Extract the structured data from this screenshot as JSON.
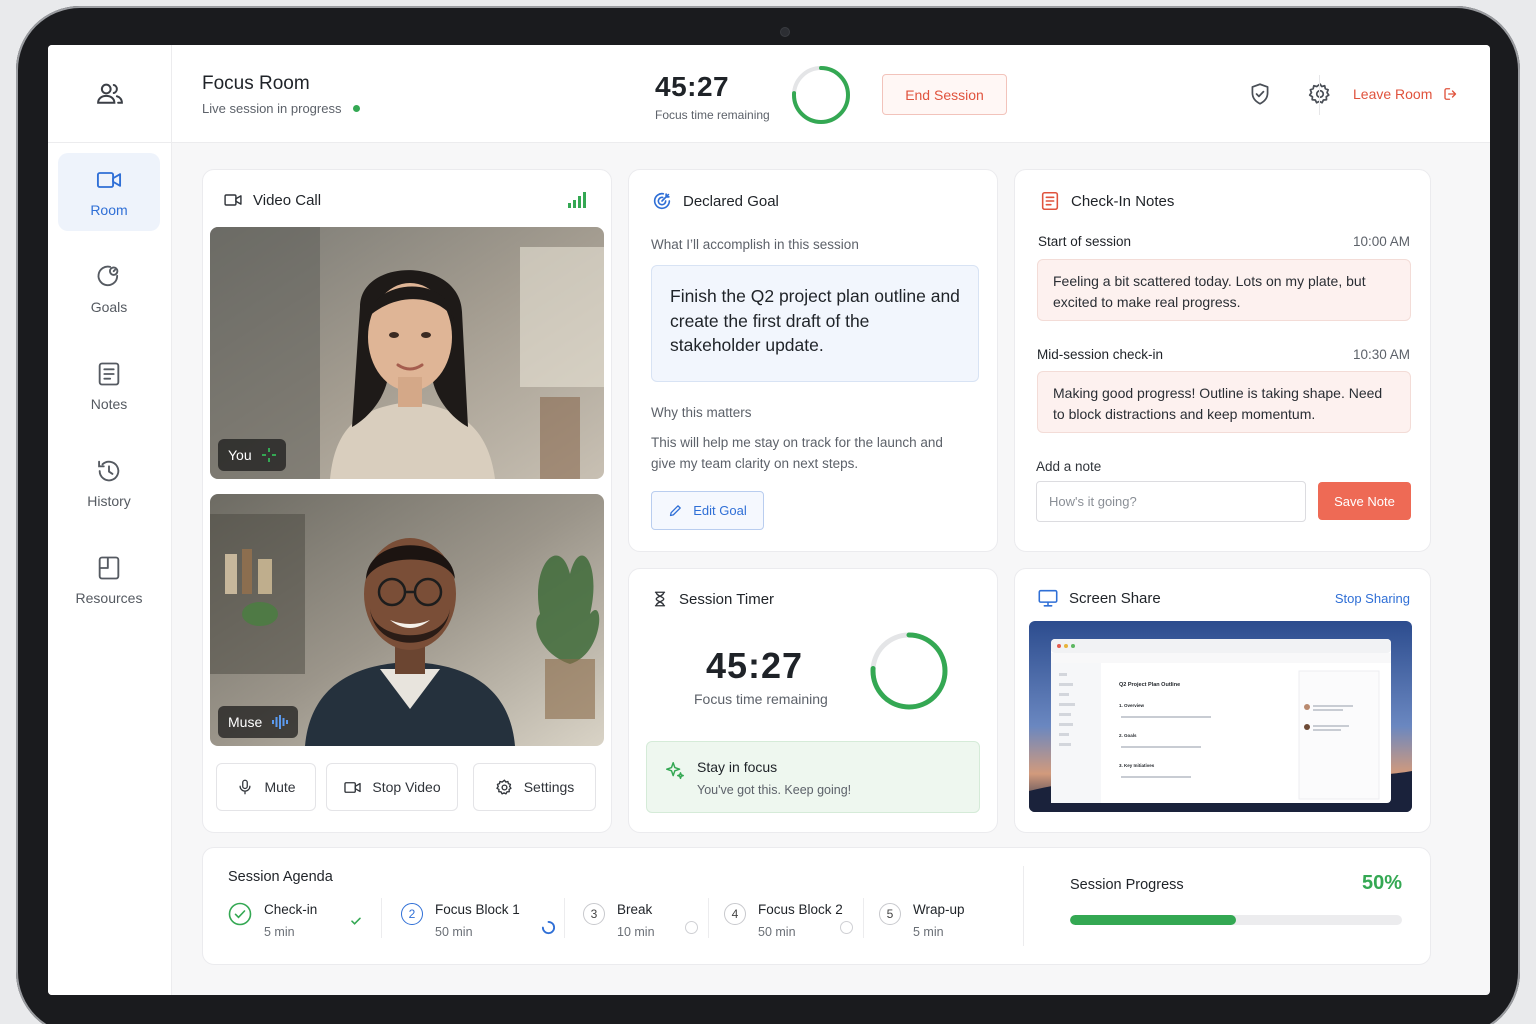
{
  "header": {
    "title": "Focus Room",
    "subtitle": "Live session in progress",
    "timer": "45:27",
    "timer_caption": "Focus time remaining",
    "end_session": "End Session",
    "leave_room": "Leave Room"
  },
  "sidebar": {
    "items": [
      {
        "label": "Room",
        "icon": "video-icon",
        "active": true
      },
      {
        "label": "Goals",
        "icon": "target-icon"
      },
      {
        "label": "Notes",
        "icon": "notes-icon"
      },
      {
        "label": "History",
        "icon": "history-icon"
      },
      {
        "label": "Resources",
        "icon": "folder-icon"
      }
    ]
  },
  "video": {
    "title": "Video Call",
    "participants": [
      {
        "label": "You"
      },
      {
        "label": "Muse"
      }
    ],
    "controls": {
      "mute": "Mute",
      "stop_video": "Stop Video",
      "settings": "Settings"
    }
  },
  "goal": {
    "title": "Declared Goal",
    "prompt": "What I’ll accomplish in this session",
    "text": "Finish the Q2 project plan outline and create the first draft of the stakeholder update.",
    "why_label": "Why this matters",
    "why_text": "This will help me stay on track for the launch and give my team clarity on next steps.",
    "edit": "Edit Goal"
  },
  "notes": {
    "title": "Check-In Notes",
    "entries": [
      {
        "label": "Start of session",
        "time": "10:00 AM",
        "text": "Feeling a bit scattered today. Lots on my plate, but excited to make real progress."
      },
      {
        "label": "Mid-session check-in",
        "time": "10:30 AM",
        "text": "Making good progress! Outline is taking shape. Need to block distractions and keep momentum."
      }
    ],
    "add_label": "Add a note",
    "placeholder": "How's it going?",
    "save": "Save Note"
  },
  "timer": {
    "title": "Session Timer",
    "value": "45:27",
    "caption": "Focus time remaining",
    "progress": 0.76,
    "tip_title": "Stay in focus",
    "tip_text": "You've got this. Keep going!"
  },
  "screen_share": {
    "title": "Screen Share",
    "stop": "Stop Sharing",
    "doc_title": "Q2 Project Plan Outline",
    "doc_sections": [
      "1. Overview",
      "2. Goals",
      "3. Key Initiatives"
    ]
  },
  "agenda": {
    "title": "Session Agenda",
    "steps": [
      {
        "num": "1",
        "name": "Check-in",
        "duration": "5 min",
        "status": "done"
      },
      {
        "num": "2",
        "name": "Focus Block 1",
        "duration": "50 min",
        "status": "current"
      },
      {
        "num": "3",
        "name": "Break",
        "duration": "10 min",
        "status": "pending"
      },
      {
        "num": "4",
        "name": "Focus Block 2",
        "duration": "50 min",
        "status": "pending"
      },
      {
        "num": "5",
        "name": "Wrap-up",
        "duration": "5 min",
        "status": "pending"
      }
    ]
  },
  "progress": {
    "title": "Session Progress",
    "value_text": "50%",
    "value": 0.5
  },
  "colors": {
    "accent_blue": "#2f6fd6",
    "accent_red": "#e0533d",
    "accent_green": "#34a853"
  }
}
